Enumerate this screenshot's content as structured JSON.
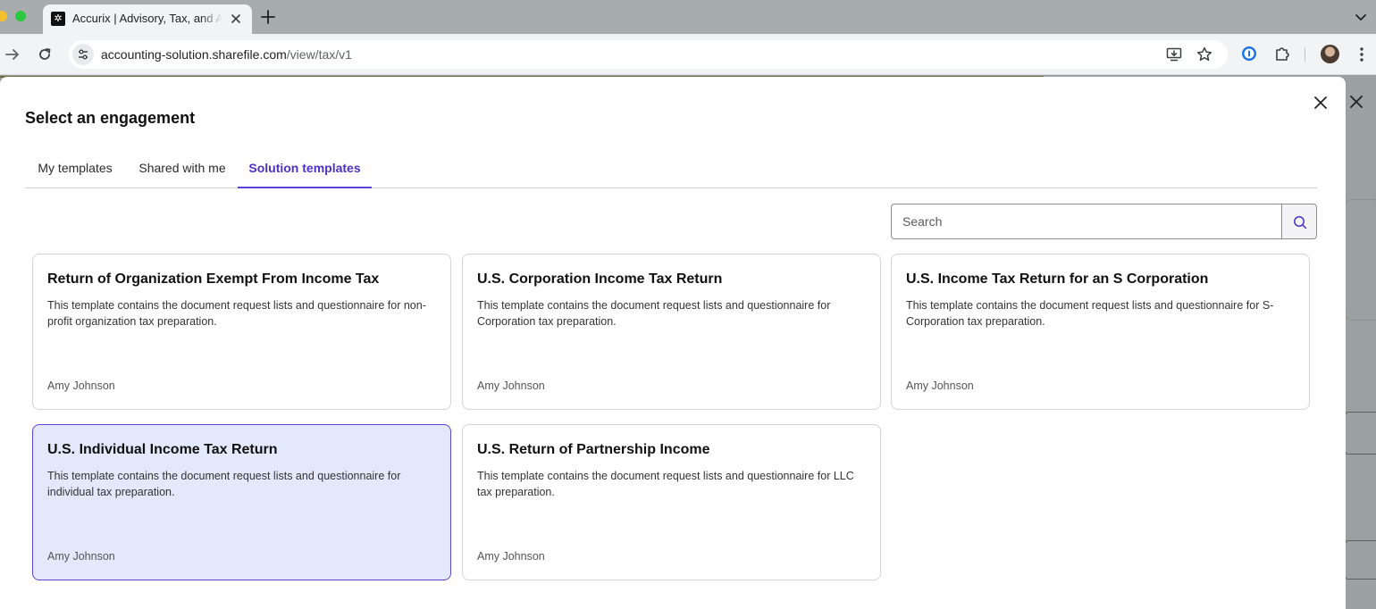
{
  "browser": {
    "tab": {
      "title": "Accurix | Advisory, Tax, and Accounting",
      "favicon": "accurix-logo-icon"
    },
    "address_bar": {
      "host": "accounting-solution.sharefile.com",
      "path": "/view/tax/v1"
    }
  },
  "modal": {
    "title": "Select an engagement",
    "tabs": [
      {
        "label": "My templates",
        "active": false
      },
      {
        "label": "Shared with me",
        "active": false
      },
      {
        "label": "Solution templates",
        "active": true
      }
    ],
    "search": {
      "placeholder": "Search",
      "value": ""
    },
    "cards": [
      {
        "title": "Return of Organization Exempt From Income Tax",
        "description": "This template contains the document request lists and questionnaire for non-profit organization tax preparation.",
        "author": "Amy Johnson",
        "selected": false
      },
      {
        "title": "U.S. Corporation Income Tax Return",
        "description": "This template contains the document request lists and questionnaire for Corporation tax preparation.",
        "author": "Amy Johnson",
        "selected": false
      },
      {
        "title": "U.S. Income Tax Return for an S Corporation",
        "description": "This template contains the document request lists and questionnaire for S-Corporation tax preparation.",
        "author": "Amy Johnson",
        "selected": false
      },
      {
        "title": "U.S. Individual Income Tax Return",
        "description": "This template contains the document request lists and questionnaire for individual tax preparation.",
        "author": "Amy Johnson",
        "selected": true
      },
      {
        "title": "U.S. Return of Partnership Income",
        "description": "This template contains the document request lists and questionnaire for LLC tax preparation.",
        "author": "Amy Johnson",
        "selected": false
      }
    ]
  },
  "colors": {
    "accent": "#5b43d6",
    "selected_card_bg": "#e3e8fb"
  }
}
